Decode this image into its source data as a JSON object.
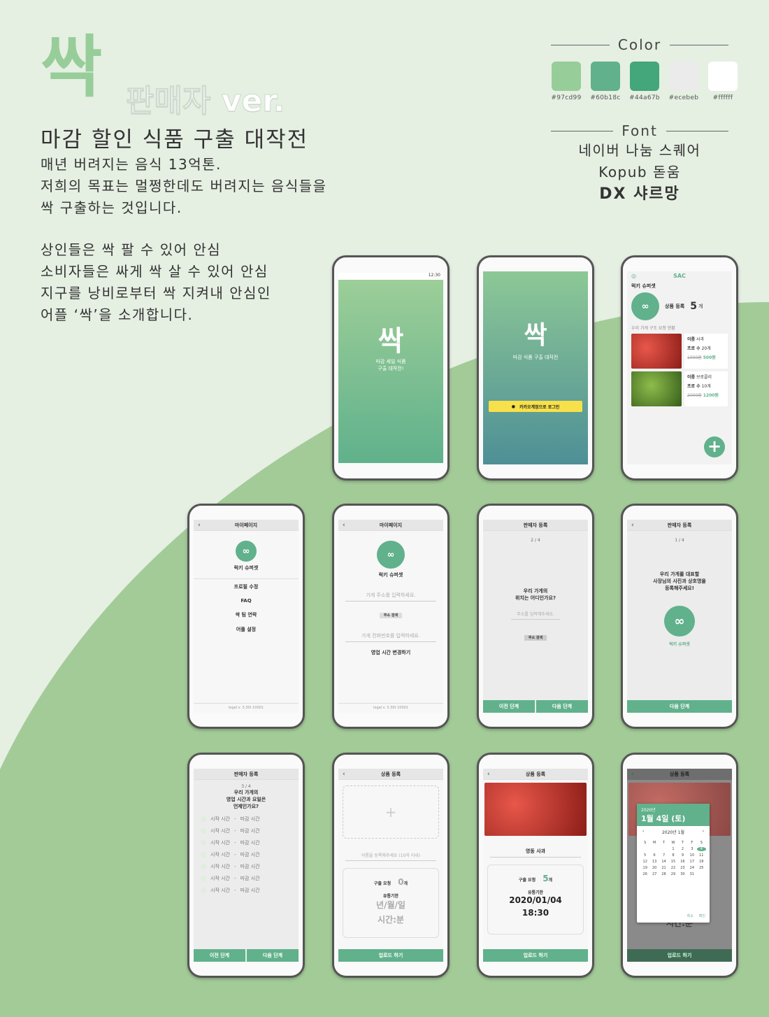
{
  "title": {
    "logo": "싹",
    "version": "판매자 ver.",
    "subtitle": "마감 할인 식품 구출 대작전"
  },
  "intro": {
    "lines": [
      "매년 버려지는 음식 13억톤.",
      "저희의 목표는 멀쩡한데도 버려지는 음식들을",
      "싹 구출하는 것입니다."
    ]
  },
  "intro2": {
    "lines": [
      "상인들은 싹 팔 수 있어 안심",
      "소비자들은 싸게 싹 살 수 있어 안심",
      "지구를 낭비로부터 싹 지켜내 안심인",
      "어플 ‘싹’을 소개합니다."
    ]
  },
  "palette": {
    "heading": "Color",
    "colors": [
      {
        "hex": "#97cd99",
        "label": "#97cd99"
      },
      {
        "hex": "#60b18c",
        "label": "#60b18c"
      },
      {
        "hex": "#44a67b",
        "label": "#44a67b"
      },
      {
        "hex": "#ecebeb",
        "label": "#ecebeb"
      },
      {
        "hex": "#ffffff",
        "label": "#ffffff"
      }
    ]
  },
  "fonts": {
    "heading": "Font",
    "items": [
      "네이버 나눔 스퀘어",
      "Kopub 돋움",
      "DX 샤르망"
    ]
  },
  "screens": {
    "splash": {
      "status": "12:30",
      "logo": "싹",
      "tagline_1": "마감 세일 식품",
      "tagline_2": "구출 대작전!"
    },
    "login": {
      "logo": "싹",
      "tagline": "마감 식품 구출 대작전",
      "kakao_button": "카카오계정으로 로그인"
    },
    "home": {
      "brand": "SAC",
      "store": "럭키 슈퍼셋",
      "product_reg": "상품 등록",
      "count": "5",
      "count_unit": "개",
      "status_label": "우리 가게 구조 요청 현황",
      "products": [
        {
          "name_label": "이름",
          "name": "사과",
          "qty_label": "프로 수",
          "qty": "20개",
          "old_price": "1000원",
          "price": "500원"
        },
        {
          "name_label": "이름",
          "name": "브로콜리",
          "qty_label": "프로 수",
          "qty": "10개",
          "old_price": "2000원",
          "price": "1200원"
        }
      ],
      "fab": "+"
    },
    "mypage1": {
      "title": "마이페이지",
      "store": "럭키 슈퍼셋",
      "menu": [
        "프로필 수정",
        "FAQ",
        "싹 팀 연락",
        "어플 설정"
      ],
      "footer": "legal v. 3.30t 10001"
    },
    "mypage2": {
      "title": "마이페이지",
      "store": "럭키 슈퍼셋",
      "address_placeholder": "가게 주소를 입력하세요.",
      "address_search": "주소 검색",
      "phone_placeholder": "가게 전화번호를 입력하세요.",
      "hours_change": "영업 시간 변경하기",
      "footer": "legal v. 3.30t 10001"
    },
    "seller_reg2": {
      "title": "판매자 등록",
      "step": "2 / 4",
      "question_1": "우리 가게의",
      "question_2": "위치는 어디인가요?",
      "address_placeholder": "주소를 입력해주세요.",
      "address_search": "주소 검색",
      "prev": "이전 단계",
      "next": "다음 단계"
    },
    "seller_reg1": {
      "title": "판매자 등록",
      "step": "1 / 4",
      "question_1": "우리 가게를 대표할",
      "question_2": "사장님의 사진과 상호명을",
      "question_3": "등록해주세요!",
      "store": "럭키 슈퍼셋",
      "next": "다음 단계"
    },
    "seller_reg3": {
      "title": "판매자 등록",
      "step": "3 / 4",
      "question_1": "우리 가게의",
      "question_2": "영업 시간과 요일은",
      "question_3": "언제인가요?",
      "days": [
        "월",
        "화",
        "수",
        "목",
        "금",
        "토",
        "일"
      ],
      "start": "시작 시간",
      "dash": "-",
      "end": "마감 시간",
      "prev": "이전 단계",
      "next": "다음 단계"
    },
    "product_reg1": {
      "title": "상품 등록",
      "plus": "+",
      "name_placeholder": "이름을 등록해주세요 (10자 이내)",
      "qty_label": "구출 요청",
      "qty": "0",
      "qty_unit": "개",
      "expiry_label": "유통기한",
      "date_placeholder": "년/월/일",
      "time_placeholder": "시간:분",
      "upload": "업로드 하기"
    },
    "product_reg2": {
      "title": "상품 등록",
      "name": "영동 사과",
      "qty_label": "구출 요청",
      "qty": "5",
      "qty_unit": "개",
      "expiry_label": "유통기한",
      "date": "2020/01/04",
      "time": "18:30",
      "upload": "업로드 하기"
    },
    "product_reg3": {
      "title": "상품 등록",
      "cal_year": "2020년",
      "cal_date": "1월 4일 (토)",
      "cal_month": "2020년 1월",
      "weekdays": [
        "S",
        "M",
        "T",
        "W",
        "T",
        "F",
        "S"
      ],
      "cancel": "취소",
      "ok": "확인",
      "time_placeholder": "시간:분",
      "upload": "업로드 하기"
    }
  }
}
